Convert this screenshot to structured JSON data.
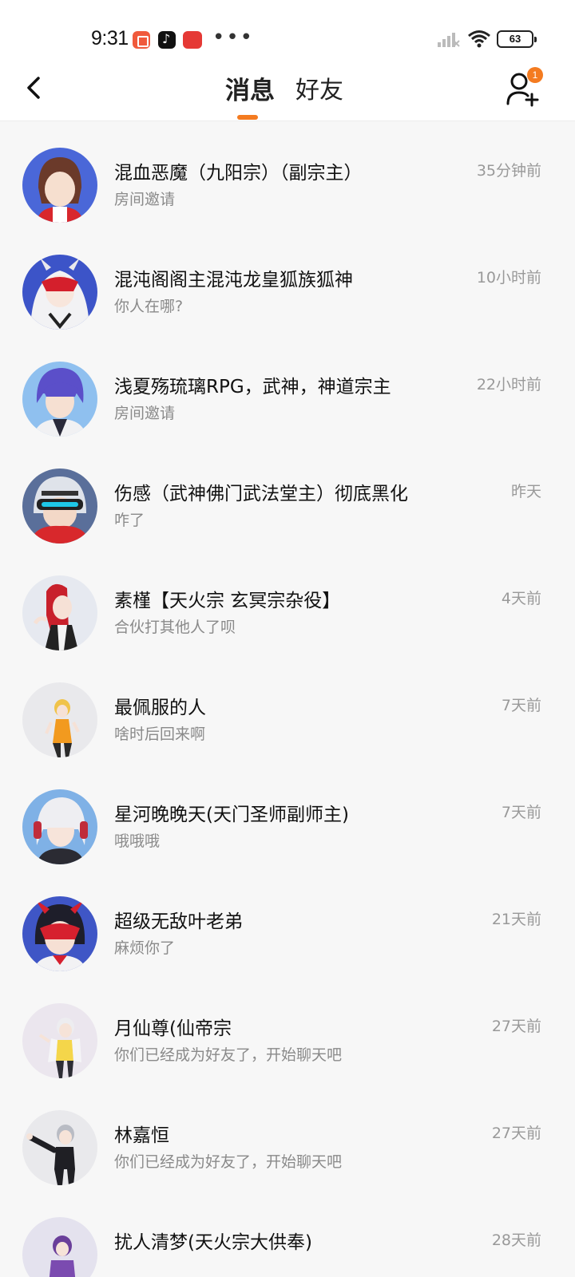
{
  "status_bar": {
    "time": "9:31",
    "dots": "•••",
    "battery": "63",
    "icons": [
      "app-notification-icon",
      "tiktok-icon",
      "app-badge-icon",
      "signal-icon",
      "wifi-icon",
      "battery-icon"
    ]
  },
  "header": {
    "tabs": [
      {
        "label": "消息",
        "active": true
      },
      {
        "label": "好友",
        "active": false
      }
    ],
    "add_friend_badge": "1",
    "accent_color": "#f47b20"
  },
  "conversations": [
    {
      "name": "混血恶魔（九阳宗）（副宗主）",
      "preview": "房间邀请",
      "time": "35分钟前"
    },
    {
      "name": "混沌阁阁主混沌龙皇狐族狐神",
      "preview": "你人在哪?",
      "time": "10小时前"
    },
    {
      "name": "浅夏殇琉璃RPG，武神，神道宗主",
      "preview": "房间邀请",
      "time": "22小时前"
    },
    {
      "name": "伤感（武神佛门武法堂主）彻底黑化",
      "preview": "咋了",
      "time": "昨天"
    },
    {
      "name": "素槿【天火宗 玄冥宗杂役】",
      "preview": "合伙打其他人了呗",
      "time": "4天前"
    },
    {
      "name": "最佩服的人",
      "preview": "啥时后回来啊",
      "time": "7天前"
    },
    {
      "name": "星河晚晚天(天门圣师副师主)",
      "preview": "哦哦哦",
      "time": "7天前"
    },
    {
      "name": "超级无敌叶老弟",
      "preview": "麻烦你了",
      "time": "21天前"
    },
    {
      "name": "月仙尊(仙帝宗",
      "preview": "你们已经成为好友了，开始聊天吧",
      "time": "27天前"
    },
    {
      "name": "林嘉恒",
      "preview": "你们已经成为好友了，开始聊天吧",
      "time": "27天前"
    },
    {
      "name": "扰人清梦(天火宗大供奉)",
      "preview": "",
      "time": "28天前"
    }
  ]
}
